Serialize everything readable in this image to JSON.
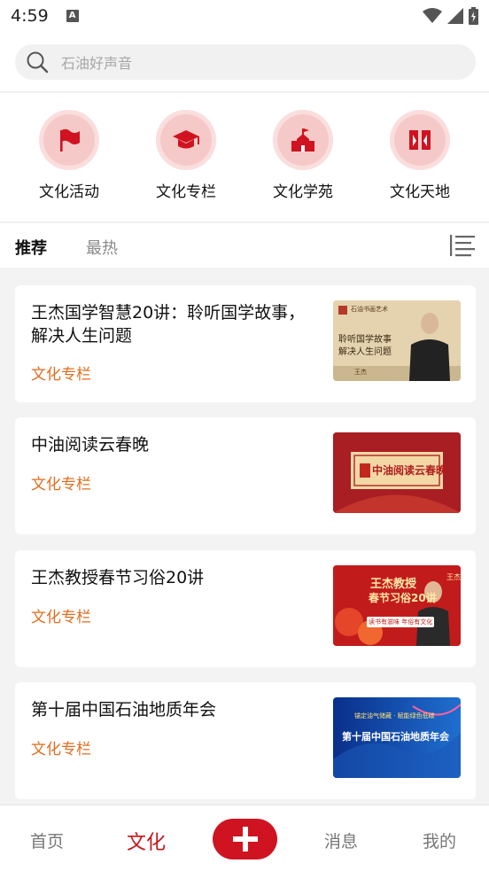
{
  "statusbar": {
    "time": "4:59",
    "badge": "A"
  },
  "search": {
    "placeholder": "石油好声音"
  },
  "categories": [
    {
      "label": "文化活动",
      "icon": "flag-icon"
    },
    {
      "label": "文化专栏",
      "icon": "graduation-cap-icon"
    },
    {
      "label": "文化学苑",
      "icon": "school-building-icon"
    },
    {
      "label": "文化天地",
      "icon": "book-icon"
    }
  ],
  "tabs": {
    "active": "推荐",
    "inactive": "最热"
  },
  "articles": [
    {
      "title": "王杰国学智慧20讲：聆听国学故事，解决人生问题",
      "tag": "文化专栏",
      "thumb": {
        "top_text": "石油书画艺术",
        "main_text": "聆听国学故事\n解决人生问题",
        "footer": "王杰"
      }
    },
    {
      "title": "中油阅读云春晚",
      "tag": "文化专栏",
      "thumb": {
        "banner": "中油阅读云春晚"
      }
    },
    {
      "title": "王杰教授春节习俗20讲",
      "tag": "文化专栏",
      "thumb": {
        "main_text": "王杰教授",
        "sub_text": "春节习俗20讲",
        "ribbon": "读书有滋味 年俗有文化",
        "side": "王杰"
      }
    },
    {
      "title": "第十届中国石油地质年会",
      "tag": "文化专栏",
      "thumb": {
        "top_text": "锚定油气储藏 · 赋能绿色低碳",
        "main_text": "第十届中国石油地质年会"
      }
    }
  ],
  "tabbar": {
    "home": "首页",
    "culture": "文化",
    "messages": "消息",
    "mine": "我的"
  },
  "colors": {
    "accent": "#c4161c",
    "tag": "#e06e1e",
    "icon_bg": "#fadede"
  }
}
